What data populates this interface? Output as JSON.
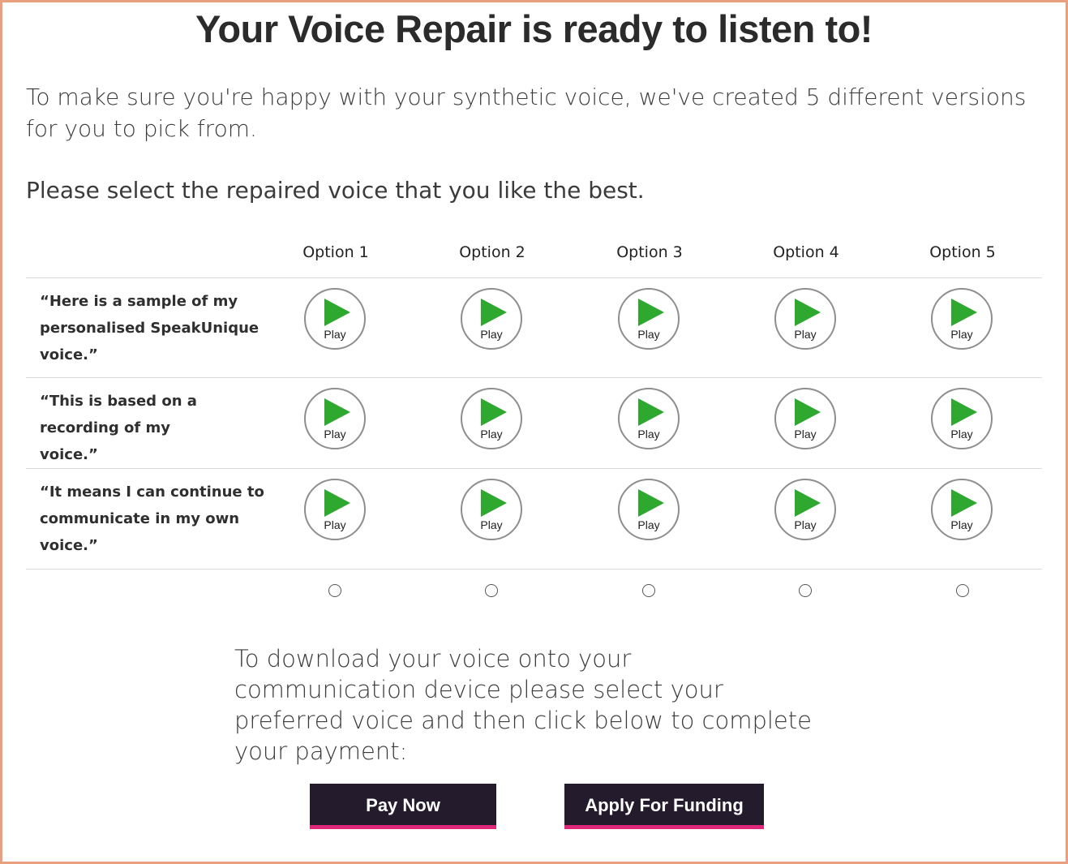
{
  "title": "Your Voice Repair is ready to listen to!",
  "intro": "To make sure you're happy with your synthetic voice, we've created 5 different versions for you to pick from.",
  "select_prompt": "Please select the repaired voice that you like the best.",
  "options": [
    "Option 1",
    "Option 2",
    "Option 3",
    "Option 4",
    "Option 5"
  ],
  "rows": [
    {
      "quote": "“Here is a sample of my personalised SpeakUnique voice.”"
    },
    {
      "quote": "“This is based on a recording of my voice.”"
    },
    {
      "quote": "“It means I can continue to communicate in my own voice.”"
    }
  ],
  "play_label": "Play",
  "download_text": "To download your voice onto your communication device please select your preferred voice and then click below to complete your payment:",
  "buttons": {
    "pay_now": "Pay Now",
    "apply_funding": "Apply For Funding"
  },
  "colors": {
    "border": "#e9a07f",
    "play_icon": "#2fa830",
    "button_bg": "#241b2d",
    "button_accent": "#e0287a"
  }
}
